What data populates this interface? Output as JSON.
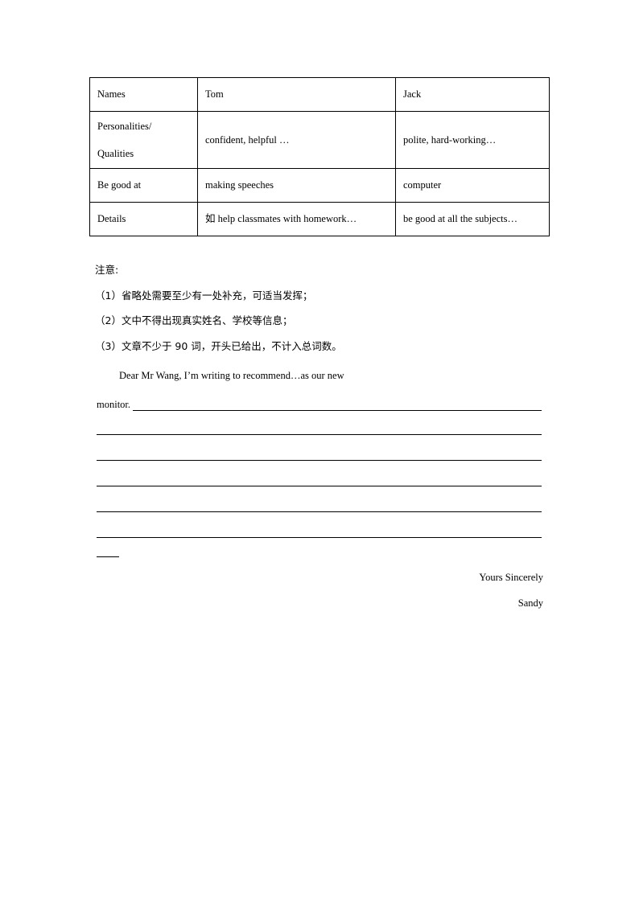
{
  "document": {
    "type": "english-writing-task-worksheet",
    "background_color": "#ffffff",
    "text_color": "#000000"
  },
  "table": {
    "columns": [
      "label",
      "tom",
      "jack"
    ],
    "rows": [
      {
        "label": "Names",
        "tom": "Tom",
        "jack": "Jack"
      },
      {
        "label_line1": "Personalities/",
        "label_line2": "Qualities",
        "tom": "confident, helpful …",
        "jack": "polite, hard-working…"
      },
      {
        "label": "Be good at",
        "tom": "making speeches",
        "jack": "computer"
      },
      {
        "label": "Details",
        "tom": "如 help classmates with homework…",
        "jack": "be good at all the subjects…"
      }
    ]
  },
  "notes": {
    "title": "注意:",
    "items": [
      "（1）省略处需要至少有一处补充，可适当发挥；",
      "（2）文中不得出现真实姓名、学校等信息；",
      "（3）文章不少于 90 词，开头已给出，不计入总词数。"
    ]
  },
  "letter": {
    "opening_line1": "Dear Mr Wang, I’m writing to recommend…as our new",
    "opening_line2": "monitor.",
    "closing": "Yours Sincerely",
    "signature": "Sandy"
  },
  "writing_lines": {
    "count": 6,
    "stub_present": true
  }
}
